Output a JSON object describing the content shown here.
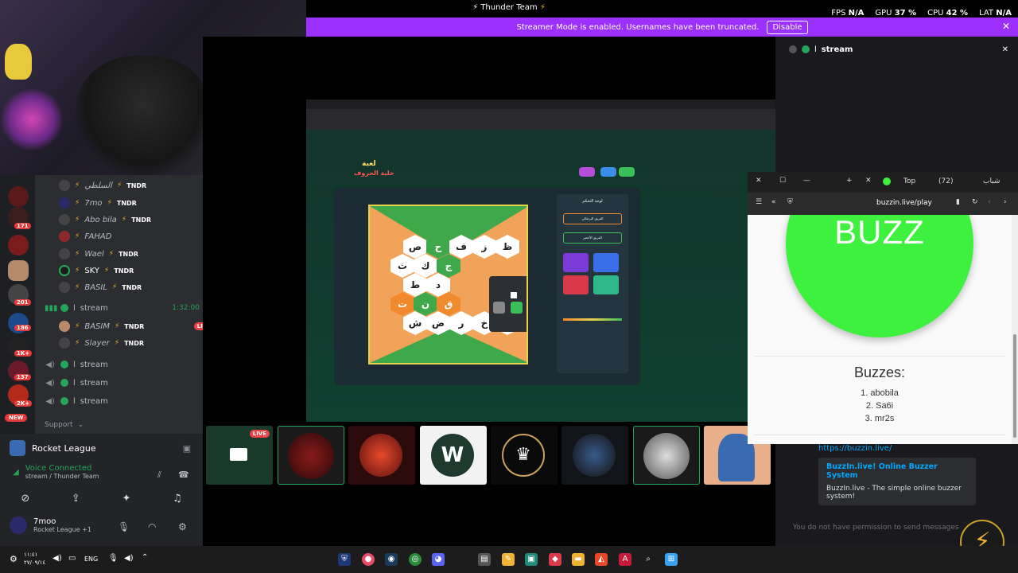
{
  "topbar": {
    "title": "Thunder Team",
    "stats": [
      {
        "label": "FPS",
        "value": "N/A"
      },
      {
        "label": "GPU",
        "value": "37 %"
      },
      {
        "label": "CPU",
        "value": "42 %"
      },
      {
        "label": "LAT",
        "value": "N/A"
      }
    ]
  },
  "banner": {
    "text": "Streamer Mode is enabled. Usernames have been truncated.",
    "button": "Disable"
  },
  "rail_badges": [
    "171",
    "201",
    "186",
    "1K+",
    "137",
    "2K+",
    "NEW"
  ],
  "voice_members": [
    {
      "name": "السلطي",
      "tag": "TNDR"
    },
    {
      "name": "7mo",
      "tag": "TNDR"
    },
    {
      "name": "Abo bila",
      "tag": "TNDR"
    },
    {
      "name": "FAHAD",
      "tag": ""
    },
    {
      "name": "Wael",
      "tag": "TNDR"
    },
    {
      "name": "SKY",
      "tag": "TNDR"
    },
    {
      "name": "BASIL",
      "tag": "TNDR"
    }
  ],
  "stream_channel": {
    "name": "stream",
    "time": "1:32:00"
  },
  "stream_members": [
    {
      "name": "BASIM",
      "tag": "TNDR",
      "live": "LIVE"
    },
    {
      "name": "Slayer",
      "tag": "TNDR"
    }
  ],
  "other_channels": [
    "stream",
    "stream",
    "stream"
  ],
  "support_label": "Support",
  "activity": {
    "game": "Rocket League"
  },
  "voice": {
    "status": "Voice Connected",
    "channel": "stream / Thunder Team"
  },
  "user": {
    "name": "7moo",
    "status": "Rocket League +1"
  },
  "game": {
    "logo_line1": "لعبة",
    "logo_line2": "خلية الحروف",
    "panel_title": "لوحة التحكم",
    "team1": "الفريق البرتقالي",
    "team2": "الفريق الأخضر",
    "letters": [
      [
        "ص",
        "ح",
        "ف",
        "ز",
        "ظ"
      ],
      [
        "ث",
        "ك",
        "ج",
        "",
        ""
      ],
      [
        "ط",
        "د",
        "",
        "",
        ""
      ],
      [
        "ت",
        "ن",
        "ق",
        "",
        ""
      ],
      [
        "ش",
        "ض",
        "ر",
        "خ",
        "ه"
      ]
    ]
  },
  "thumbs_live": "LIVE",
  "right_panel": {
    "title": "stream"
  },
  "browser": {
    "tabs": [
      "Top",
      "(72)",
      "شباب"
    ],
    "url": "buzzin.live/play"
  },
  "buzz": {
    "button": "BUZZ",
    "buzzes_title": "Buzzes:",
    "list": [
      "1. abobila",
      "2. Sa6i",
      "3. mr2s"
    ]
  },
  "link": {
    "url": "https://buzzin.live/",
    "title": "BuzzIn.live! Online Buzzer System",
    "desc": "BuzzIn.live - The simple online buzzer system!"
  },
  "chat_placeholder": "You do not have permission to send messages",
  "taskbar": {
    "lang": "ENG",
    "time": "١١:٤١",
    "date": "٢٧/٠٩/١٤"
  }
}
